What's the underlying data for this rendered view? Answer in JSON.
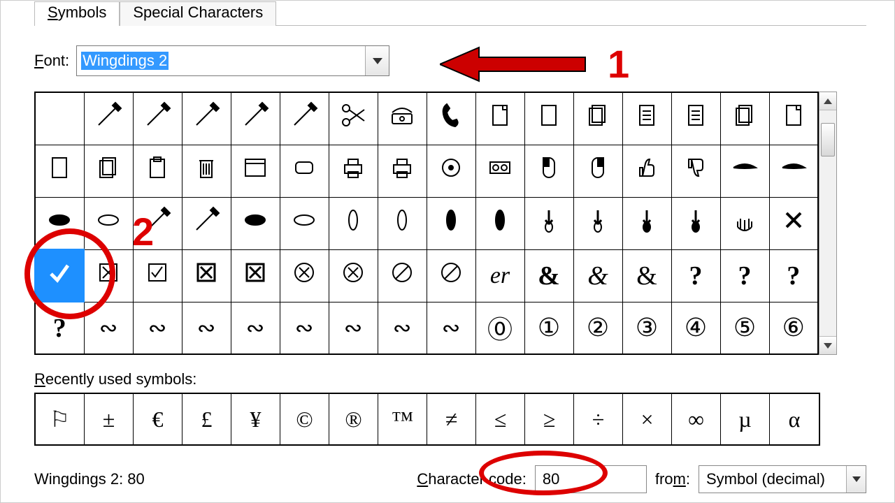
{
  "tabs": {
    "symbols": "Symbols",
    "special": "Special Characters"
  },
  "font": {
    "label": "Font:",
    "value": "Wingdings 2"
  },
  "annotations": {
    "one": "1",
    "two": "2"
  },
  "grid": {
    "rows": [
      [
        "",
        "pen-thin",
        "pen-wide",
        "brush",
        "marker",
        "scissors-open",
        "scissors-closed",
        "telephone-desk",
        "telephone-handset",
        "page-corner",
        "page-blank",
        "pages-stack",
        "document-lines-1",
        "document-lines-2",
        "documents-stack",
        "page-earmark"
      ],
      [
        "tablet-portrait",
        "tablets-stack",
        "clipboard",
        "trash-can",
        "window",
        "rounded-rect",
        "printer-1",
        "printer-2",
        "disc",
        "tape-drive",
        "mouse-left",
        "mouse-right",
        "thumbs-up",
        "thumbs-down",
        "hand-left-wing",
        "hand-right-wing"
      ],
      [
        "hand-flat-left-dark",
        "hand-flat-left-light",
        "hand-open-left",
        "hand-open-right",
        "hand-point-right-dark",
        "hand-point-right-2",
        "hand-vert-1",
        "hand-vert-2",
        "hand-vert-dark-1",
        "hand-vert-dark-2",
        "hand-down-1",
        "hand-down-2",
        "hand-down-dark-1",
        "hand-down-dark-2",
        "hand-spread",
        "x-mark"
      ],
      [
        "check-mark",
        "checkbox-x",
        "checkbox-check",
        "box-x-1",
        "box-x-2",
        "circle-x-1",
        "circle-x-2",
        "prohibit-1",
        "prohibit-2",
        "script-er",
        "ampersand-bold",
        "ampersand-italic",
        "ampersand-small",
        "question-1",
        "question-2",
        "question-3"
      ],
      [
        "question-4",
        "flourish-cs",
        "flourish-swirl",
        "flourish-so-1",
        "flourish-so-2",
        "flourish-wave-1",
        "flourish-wave-2",
        "flourish-wave-3",
        "flourish-wave-4",
        "circled-0",
        "circled-1",
        "circled-2",
        "circled-3",
        "circled-4",
        "circled-5",
        "circled-6"
      ]
    ],
    "selected": [
      3,
      0
    ]
  },
  "recent": {
    "label": "Recently used symbols:",
    "items": [
      "⚐",
      "±",
      "€",
      "£",
      "¥",
      "©",
      "®",
      "™",
      "≠",
      "≤",
      "≥",
      "÷",
      "×",
      "∞",
      "µ",
      "α"
    ]
  },
  "status": "Wingdings 2: 80",
  "charcode": {
    "label": "Character code:",
    "value": "80"
  },
  "from": {
    "label": "from:",
    "value": "Symbol (decimal)"
  }
}
